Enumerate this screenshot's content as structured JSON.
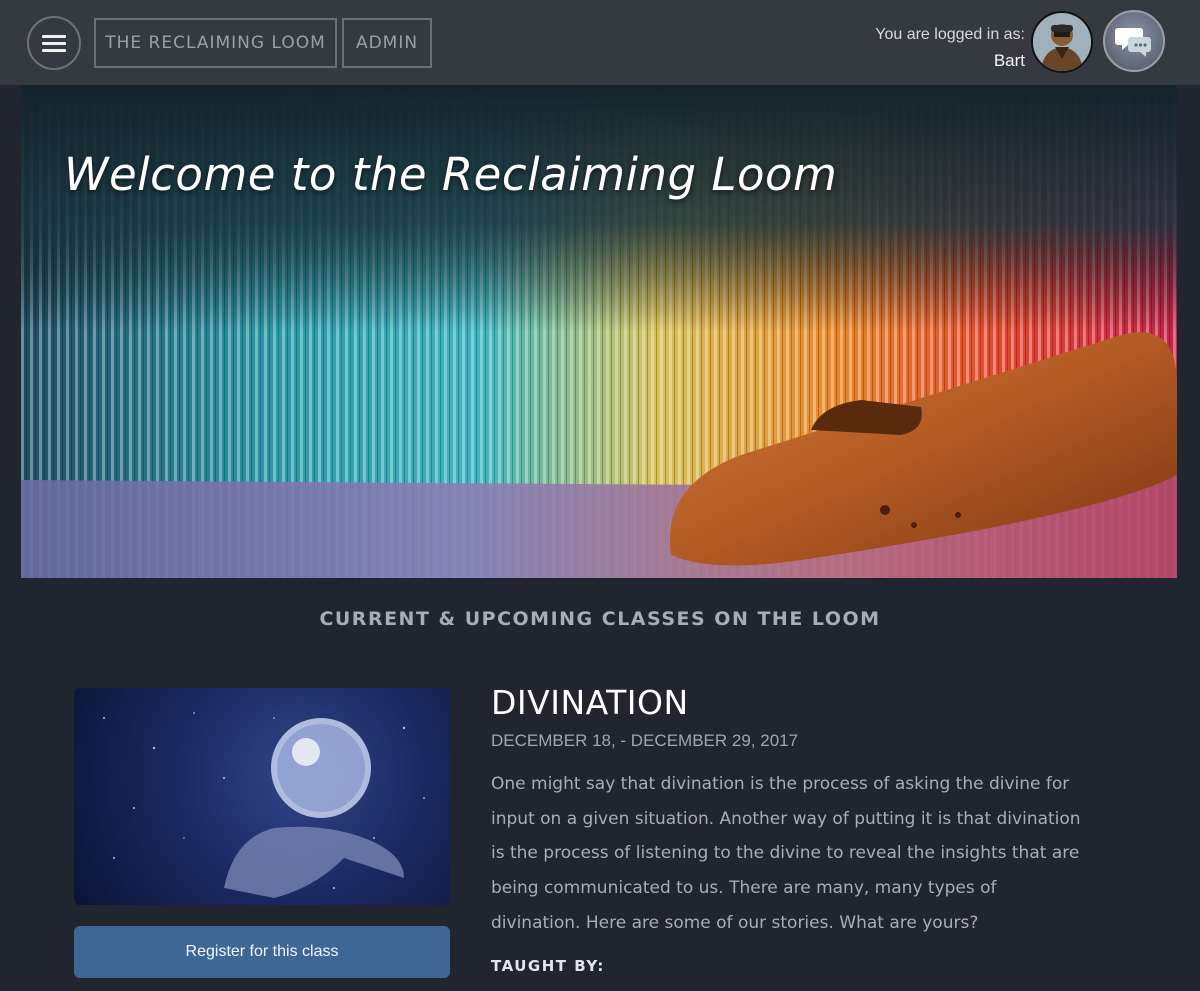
{
  "header": {
    "menu_icon": "hamburger-icon",
    "nav": [
      {
        "label": "THE RECLAIMING LOOM"
      },
      {
        "label": "ADMIN"
      }
    ],
    "login_label": "You are logged in as:",
    "username": "Bart",
    "chat_icon": "chat-bubbles-icon"
  },
  "hero": {
    "title": "Welcome to the Reclaiming Loom"
  },
  "classes_section": {
    "title": "CURRENT & UPCOMING CLASSES ON THE LOOM",
    "classes": [
      {
        "title": "DIVINATION",
        "dates": "DECEMBER 18, - DECEMBER 29, 2017",
        "description": "One might say that divination is the process of asking the divine for input on a given situation. Another way of putting it is that divination is the process of listening to the divine to reveal the insights that are being communicated to us. There are many, many types of divination. Here are some of our stories. What are yours?",
        "register_label": "Register for this class",
        "taught_by_label": "TAUGHT BY:"
      }
    ]
  }
}
